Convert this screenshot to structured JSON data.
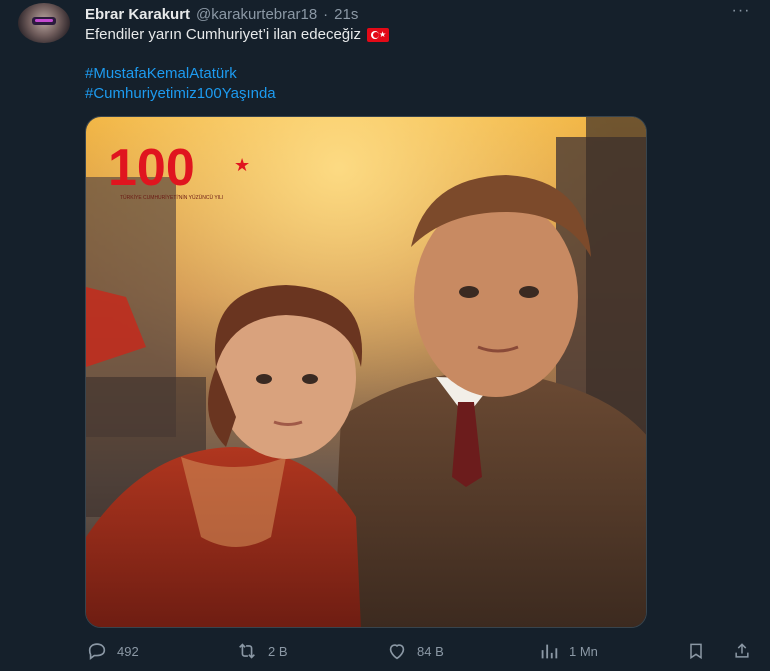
{
  "author": {
    "display_name": "Ebrar Karakurt",
    "handle": "@karakurtebrar18",
    "separator": "·",
    "time": "21s"
  },
  "more_label": "···",
  "tweet": {
    "text": "Efendiler yarın Cumhuriyet’i ilan edeceğiz",
    "emoji": "turkey-flag",
    "hashtags": [
      "#MustafaKemalAtatürk",
      "#Cumhuriyetimiz100Yaşında"
    ]
  },
  "media": {
    "logo_text": "100",
    "logo_subtitle": "TÜRKİYE CUMHURİYETİ'NİN YÜZÜNCÜ YILI"
  },
  "actions": {
    "reply_count": "492",
    "retweet_count": "2 B",
    "like_count": "84 B",
    "views_count": "1 Mn"
  },
  "colors": {
    "background": "#15202b",
    "text": "#e7e9ea",
    "muted": "#8b98a5",
    "link": "#1d9bf0"
  },
  "icons": [
    "reply-icon",
    "retweet-icon",
    "like-icon",
    "views-icon",
    "bookmark-icon",
    "share-icon",
    "more-icon"
  ]
}
